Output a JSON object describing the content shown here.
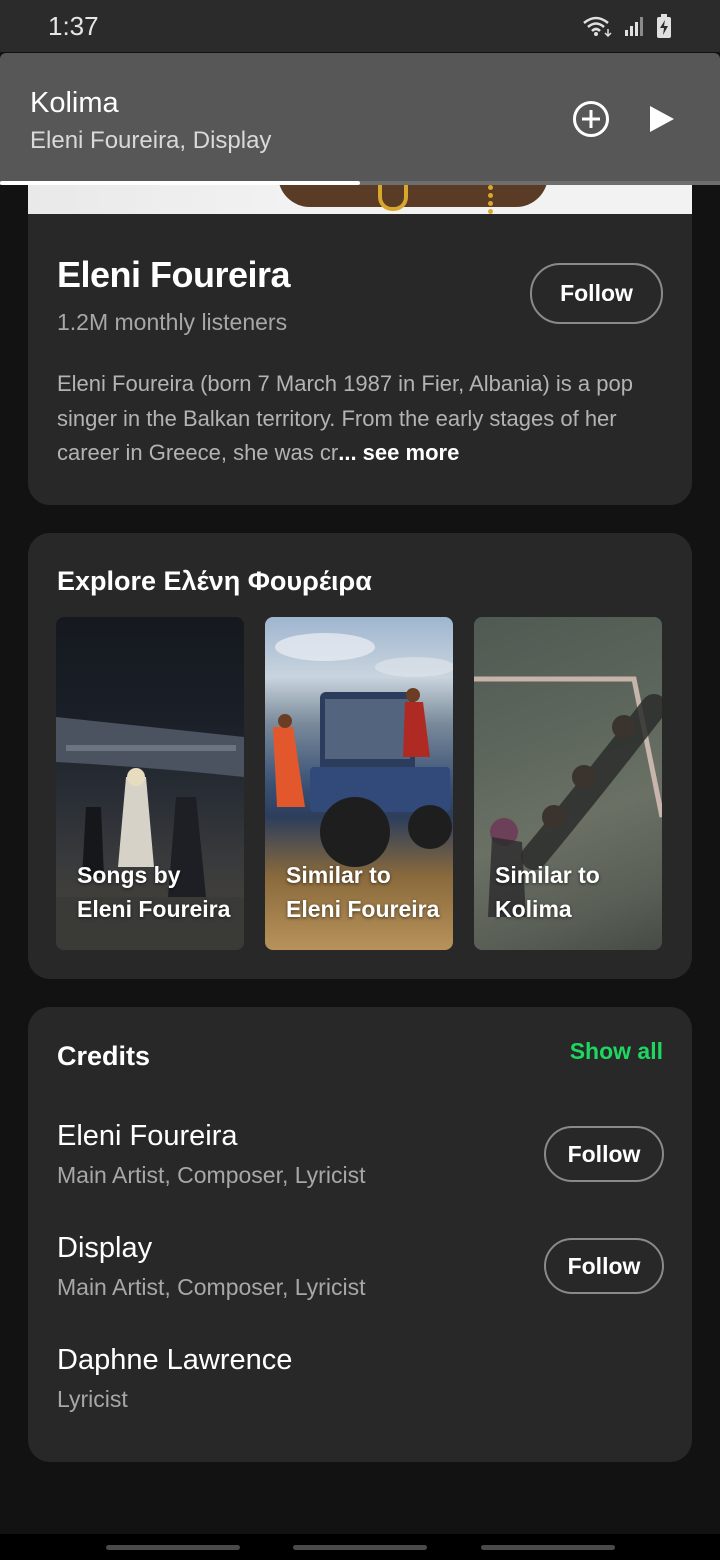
{
  "status_bar": {
    "time": "1:37",
    "icons": [
      "wifi-icon",
      "signal-icon",
      "battery-charging-icon"
    ]
  },
  "now_playing": {
    "title": "Kolima",
    "subtitle": "Eleni Foureira, Display",
    "progress_fraction": 0.5,
    "icons": [
      "add-circle-icon",
      "play-icon"
    ]
  },
  "about": {
    "artist_name": "Eleni Foureira",
    "listeners": "1.2M monthly listeners",
    "follow_label": "Follow",
    "bio": "Eleni Foureira (born 7 March 1987 in Fier, Albania) is a pop singer in the Balkan territory. From the early stages of her career in Greece, she was cr",
    "see_more": "... see more"
  },
  "explore": {
    "title": "Explore Ελένη Φουρέιρα",
    "tiles": [
      {
        "label": "Songs by Eleni Foureira"
      },
      {
        "label": "Similar to Eleni Foureira"
      },
      {
        "label": "Similar to Kolima"
      }
    ]
  },
  "credits": {
    "title": "Credits",
    "show_all": "Show all",
    "follow_label": "Follow",
    "items": [
      {
        "name": "Eleni Foureira",
        "role": "Main Artist, Composer, Lyricist"
      },
      {
        "name": "Display",
        "role": "Main Artist, Composer, Lyricist"
      },
      {
        "name": "Daphne Lawrence",
        "role": "Lyricist"
      }
    ]
  },
  "colors": {
    "background": "#121212",
    "card": "#282828",
    "now_playing_bg": "#575757",
    "accent_green": "#1ed760",
    "secondary_text": "#a7a7a7"
  }
}
